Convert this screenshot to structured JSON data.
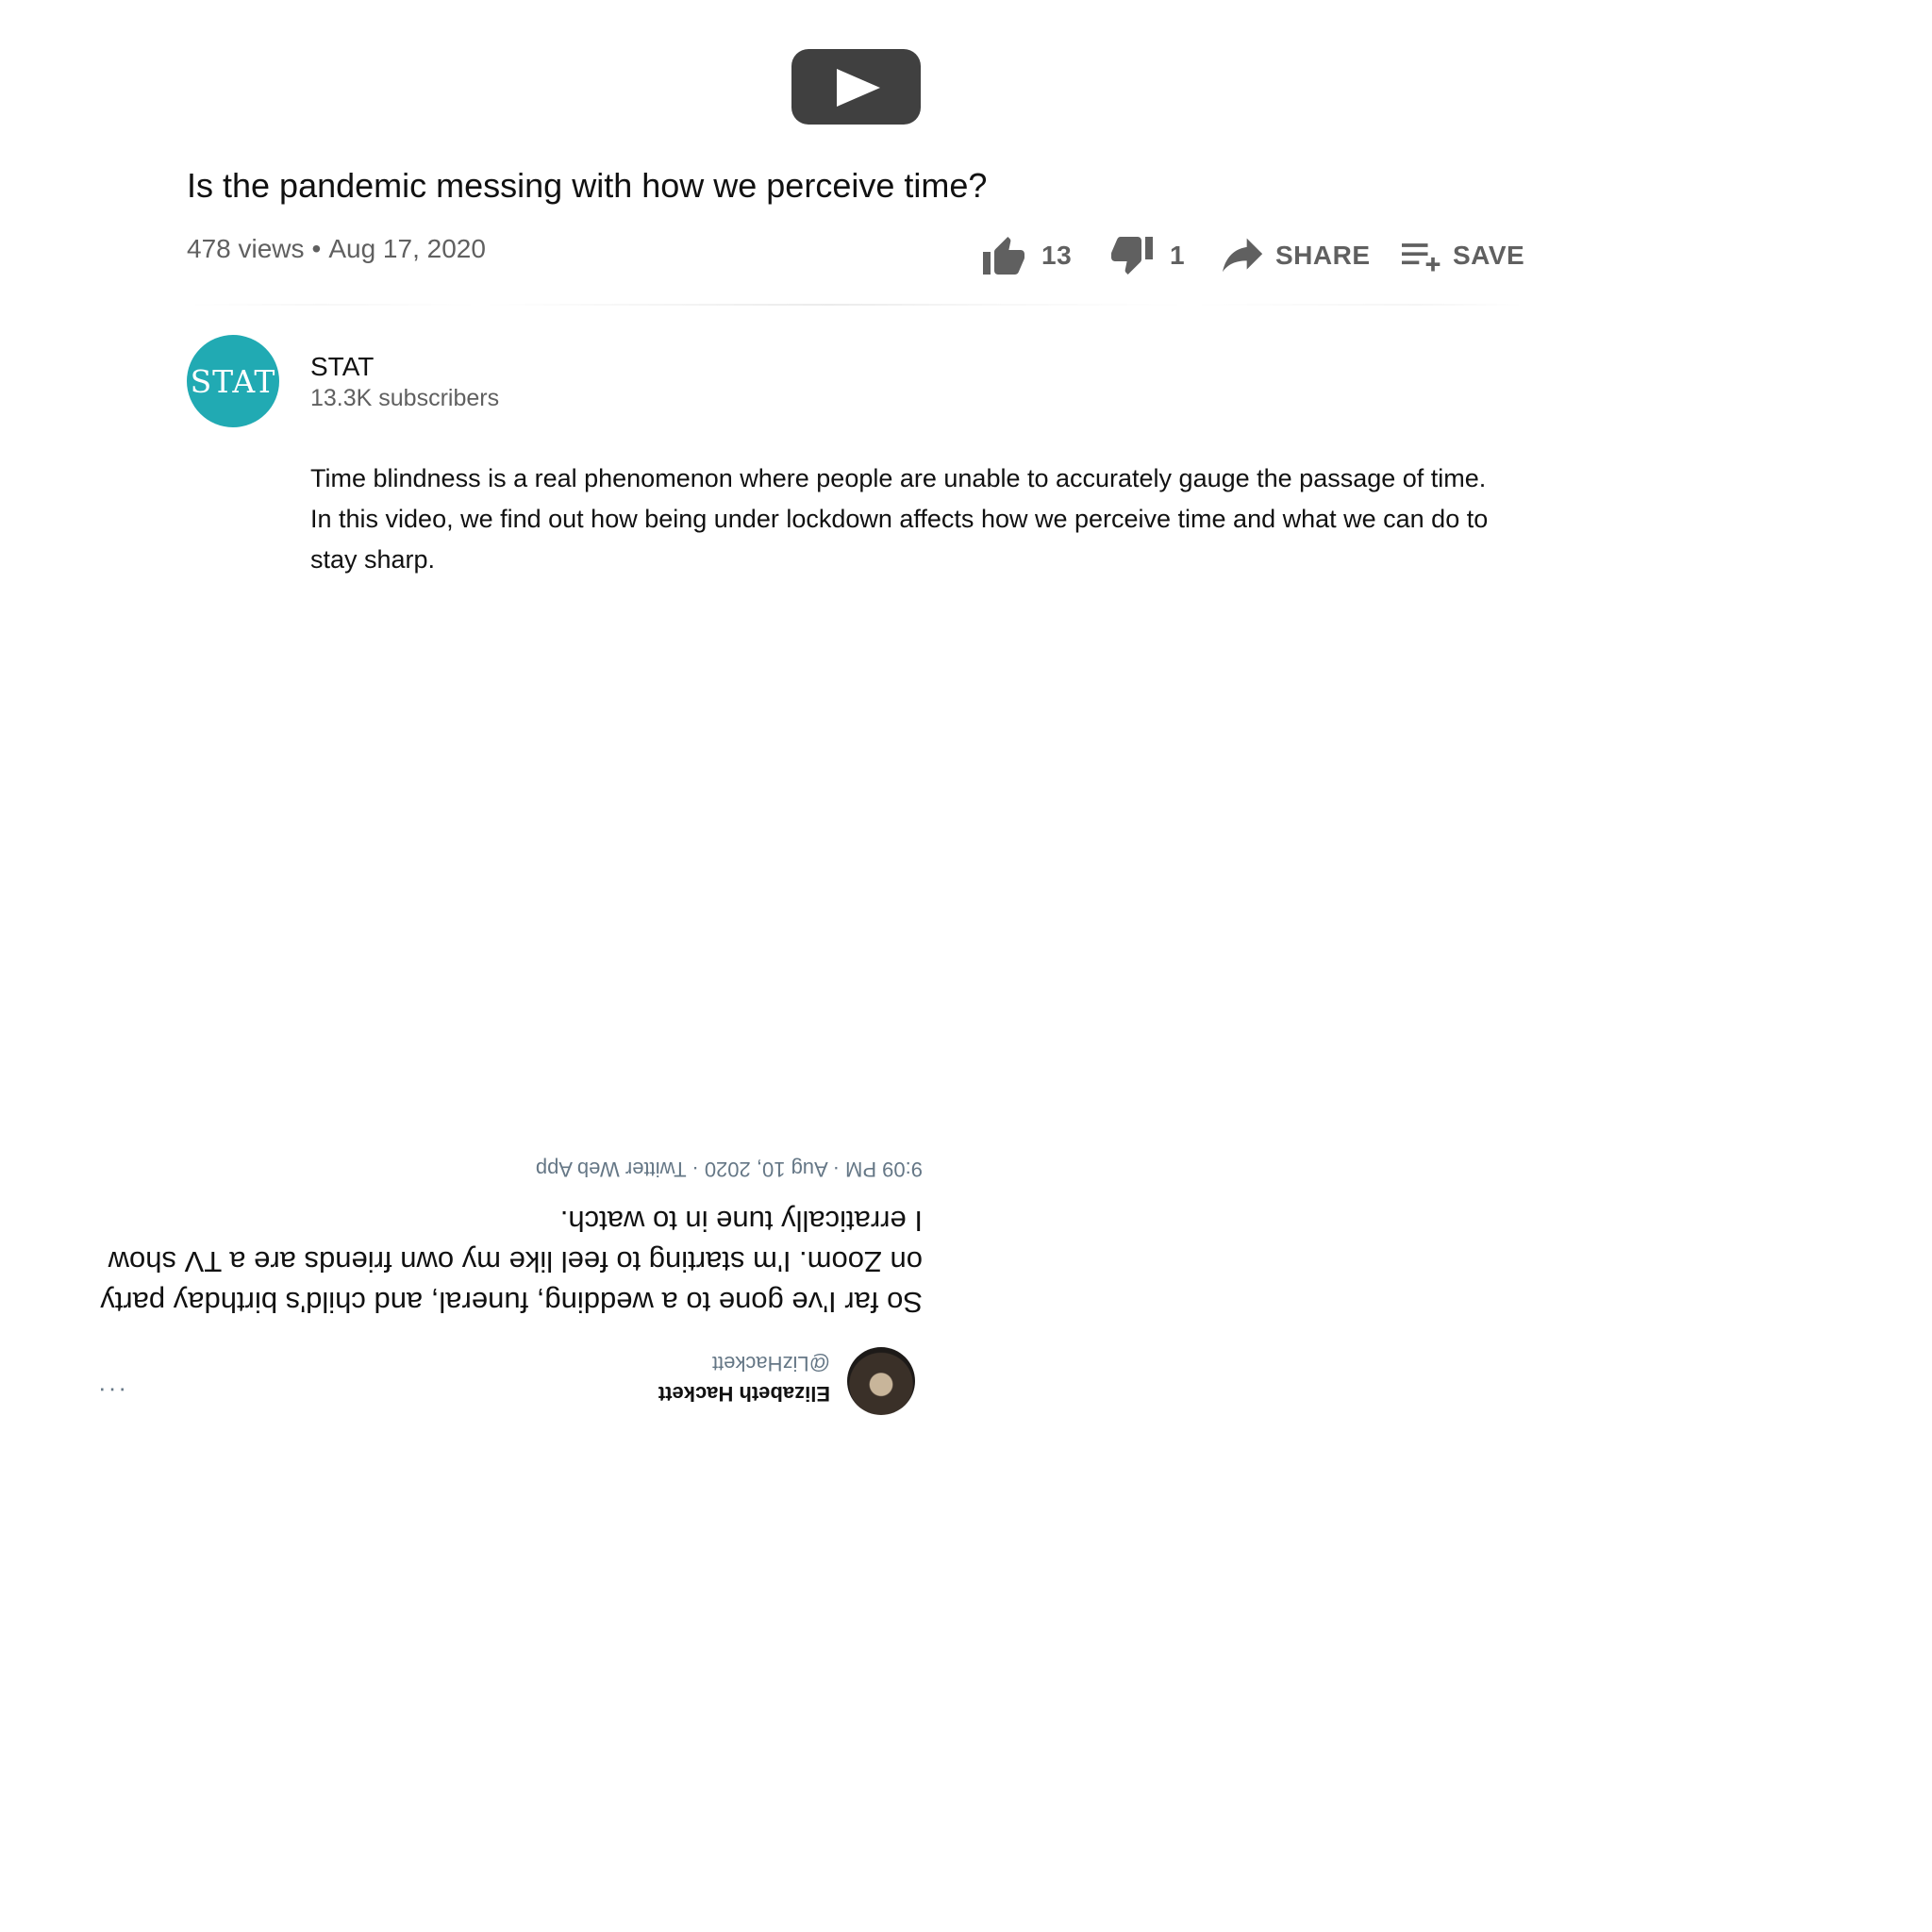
{
  "video": {
    "title": "Is the pandemic messing with how we perceive time?",
    "views": "478 views",
    "separator": "•",
    "date": "Aug 17, 2020"
  },
  "actions": {
    "likes": "13",
    "dislikes": "1",
    "share_label": "SHARE",
    "save_label": "SAVE"
  },
  "channel": {
    "logo_text": "STAT",
    "name": "STAT",
    "subscribers": "13.3K subscribers",
    "logo_color": "#21aab3"
  },
  "description": "Time blindness is a real phenomenon where people are unable to accurately gauge the passage of time. In this video, we find out how being under lockdown affects how we perceive time and what we can do to stay sharp.",
  "tweet": {
    "author_name": "Elizabeth Hackett",
    "author_handle": "@LizHackett",
    "more": "···",
    "text": "So far I've gone to a wedding, funeral, and child's birthday party on Zoom. I'm starting to feel like my own friends are a TV show I erratically tune in to watch.",
    "footer": "9:09 PM · Aug 10, 2020 · Twitter Web App"
  },
  "icons": {
    "play": "play-icon",
    "like": "thumbs-up-icon",
    "dislike": "thumbs-down-icon",
    "share": "share-arrow-icon",
    "save": "playlist-add-icon"
  }
}
